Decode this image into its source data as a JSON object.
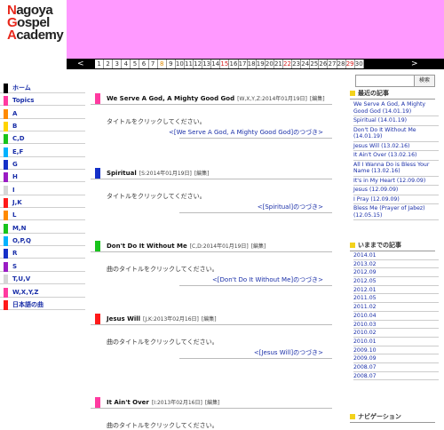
{
  "logo": {
    "line1_cap": "N",
    "line1_rest": "agoya",
    "line2_cap": "G",
    "line2_rest": "ospel",
    "line3_cap": "A",
    "line3_rest": "cademy"
  },
  "calendar": {
    "prev": "<",
    "next": ">",
    "days": [
      "1",
      "2",
      "3",
      "4",
      "5",
      "6",
      "7",
      "8",
      "9",
      "10",
      "11",
      "12",
      "13",
      "14",
      "15",
      "16",
      "17",
      "18",
      "19",
      "20",
      "21",
      "22",
      "23",
      "24",
      "25",
      "26",
      "27",
      "28",
      "29",
      "30"
    ],
    "sat_days": [
      "8"
    ],
    "sun_days": [
      "15",
      "22",
      "29"
    ]
  },
  "nav": {
    "items": [
      {
        "label": "ホーム",
        "color": "#000000"
      },
      {
        "label": "Topics",
        "color": "#ff3aa0"
      },
      {
        "label": "A",
        "color": "#ff8a00"
      },
      {
        "label": "B",
        "color": "#ffd400"
      },
      {
        "label": "C,D",
        "color": "#18c41c"
      },
      {
        "label": "E,F",
        "color": "#00b2ff"
      },
      {
        "label": "G",
        "color": "#1530c8"
      },
      {
        "label": "H",
        "color": "#9a1cc4"
      },
      {
        "label": "I",
        "color": "#d6d6d6"
      },
      {
        "label": "J,K",
        "color": "#ff1a1a"
      },
      {
        "label": "L",
        "color": "#ff8a00"
      },
      {
        "label": "M,N",
        "color": "#18c41c"
      },
      {
        "label": "O,P,Q",
        "color": "#00b2ff"
      },
      {
        "label": "R",
        "color": "#1530c8"
      },
      {
        "label": "S",
        "color": "#9a1cc4"
      },
      {
        "label": "T,U,V",
        "color": "#d6d6d6"
      },
      {
        "label": "W,X,Y,Z",
        "color": "#ff3aa0"
      },
      {
        "label": "日本語の曲",
        "color": "#ff1a1a"
      }
    ]
  },
  "posts": [
    {
      "title": "We Serve A God, A Mighty Good God",
      "meta": "[W,X,Y,Z:2014年01月19日]",
      "edit": "[編集]",
      "body": "タイトルをクリックしてください。",
      "more": "<[We Serve A God, A Mighty Good God]のつづき>",
      "color": "#ff3aa0"
    },
    {
      "title": "Spiritual",
      "meta": "[S:2014年01月19日]",
      "edit": "[編集]",
      "body": "タイトルをクリックしてください。",
      "more": "<[Spiritual]のつづき>",
      "color": "#1530c8"
    },
    {
      "title": "Don't Do It Without Me",
      "meta": "[C,D:2014年01月19日]",
      "edit": "[編集]",
      "body": "曲のタイトルをクリックしてください。",
      "more": "<[Don't Do It Without Me]のつづき>",
      "color": "#18c41c"
    },
    {
      "title": "Jesus Will",
      "meta": "[J,K:2013年02月16日]",
      "edit": "[編集]",
      "body": "曲のタイトルをクリックしてください。",
      "more": "<[Jesus Will]のつづき>",
      "color": "#ff1a1a"
    },
    {
      "title": "It Ain't Over",
      "meta": "[I:2013年02月16日]",
      "edit": "[編集]",
      "body": "曲のタイトルをクリックしてください。",
      "more": "",
      "color": "#ff3aa0"
    }
  ],
  "search": {
    "placeholder": "",
    "button": "検索"
  },
  "recent": {
    "heading": "最近の記事",
    "items": [
      "We Serve A God, A Mighty Good God (14.01.19)",
      "Spiritual (14.01.19)",
      "Don't Do It Without Me (14.01.19)",
      "Jesus Will (13.02.16)",
      "It Ain't Over (13.02.16)",
      "All I Wanna Do is Bless Your Name (13.02.16)",
      "It's in My Heart (12.09.09)",
      "Jesus (12.09.09)",
      "I Pray (12.09.09)",
      "Bless Me (Prayer of Jabez) (12.05.15)"
    ]
  },
  "archive": {
    "heading": "いままでの記事",
    "items": [
      "2014.01",
      "2013.02",
      "2012.09",
      "2012.05",
      "2012.01",
      "2011.05",
      "2011.02",
      "2010.04",
      "2010.03",
      "2010.02",
      "2010.01",
      "2009.10",
      "2009.09",
      "2008.07",
      "2008.07"
    ]
  },
  "navigation": {
    "heading": "ナビゲーション"
  }
}
